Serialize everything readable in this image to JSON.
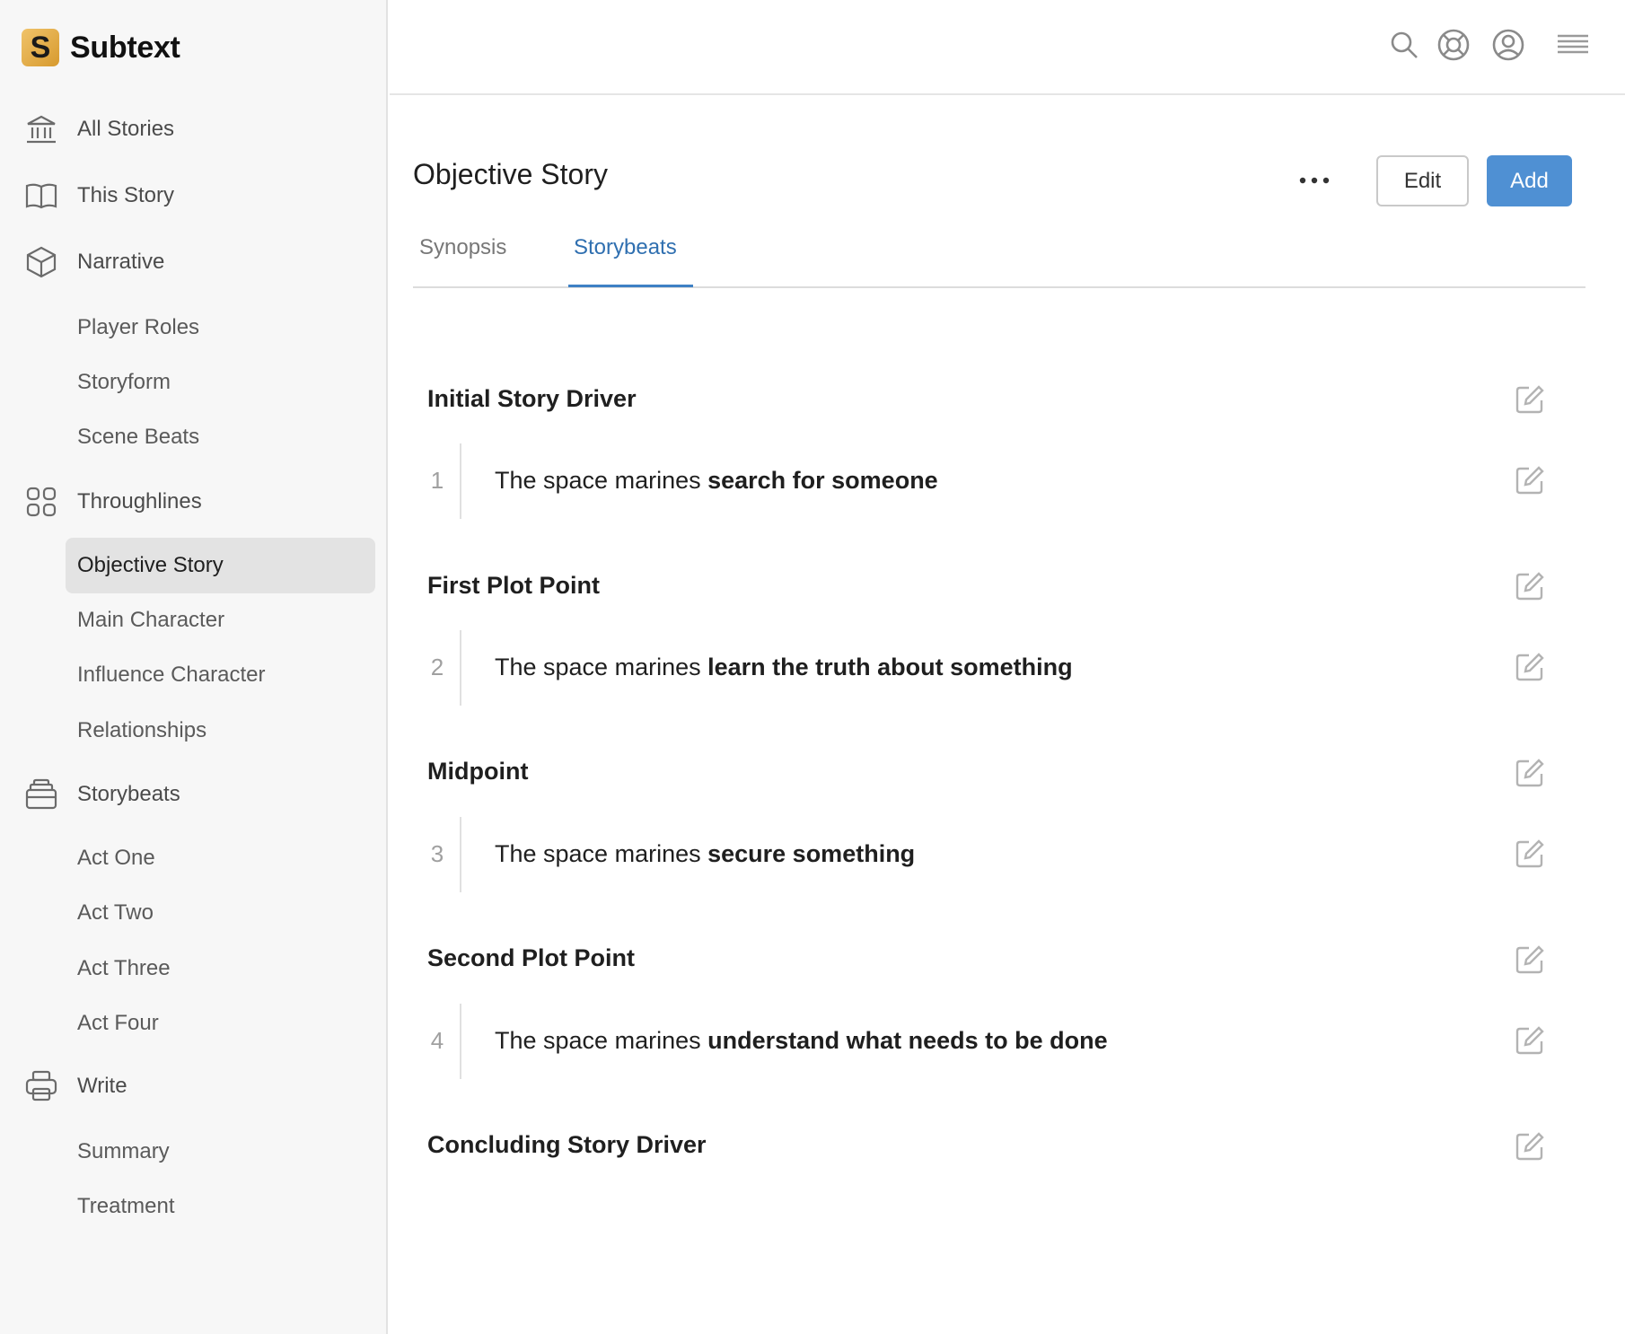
{
  "app": {
    "name": "Subtext",
    "logo_letter": "S"
  },
  "sidebar": {
    "top_items": [
      {
        "label": "All Stories",
        "icon": "bank-icon"
      },
      {
        "label": "This Story",
        "icon": "book-icon"
      },
      {
        "label": "Narrative",
        "icon": "cube-icon"
      },
      {
        "label": "Throughlines",
        "icon": "grid-icon"
      },
      {
        "label": "Storybeats",
        "icon": "stack-icon"
      },
      {
        "label": "Write",
        "icon": "printer-icon"
      }
    ],
    "narrative_items": [
      "Player Roles",
      "Storyform",
      "Scene Beats"
    ],
    "throughline_items": [
      "Objective Story",
      "Main Character",
      "Influence Character",
      "Relationships"
    ],
    "storybeat_items": [
      "Act One",
      "Act Two",
      "Act Three",
      "Act Four"
    ],
    "write_items": [
      "Summary",
      "Treatment"
    ],
    "active_item": "Objective Story"
  },
  "header": {
    "icons": [
      "search-icon",
      "help-lifebuoy-icon",
      "account-icon",
      "menu-icon"
    ]
  },
  "main": {
    "title": "Objective Story",
    "edit_label": "Edit",
    "add_label": "Add",
    "tabs": [
      {
        "label": "Synopsis",
        "active": false
      },
      {
        "label": "Storybeats",
        "active": true
      }
    ],
    "beats": [
      {
        "heading": "Initial Story Driver",
        "num": "1",
        "prefix": "The space marines ",
        "action": "search for someone"
      },
      {
        "heading": "First Plot Point",
        "num": "2",
        "prefix": "The space marines ",
        "action": "learn the truth about something"
      },
      {
        "heading": "Midpoint",
        "num": "3",
        "prefix": "The space marines ",
        "action": "secure something"
      },
      {
        "heading": "Second Plot Point",
        "num": "4",
        "prefix": "The space marines ",
        "action": "understand what needs to be done"
      }
    ],
    "final_heading": "Concluding Story Driver"
  },
  "colors": {
    "accent": "#4f90d3",
    "tab_active": "#2f6fb0",
    "logo": "#e2ad4a",
    "sidebar_bg": "#f7f7f7"
  }
}
